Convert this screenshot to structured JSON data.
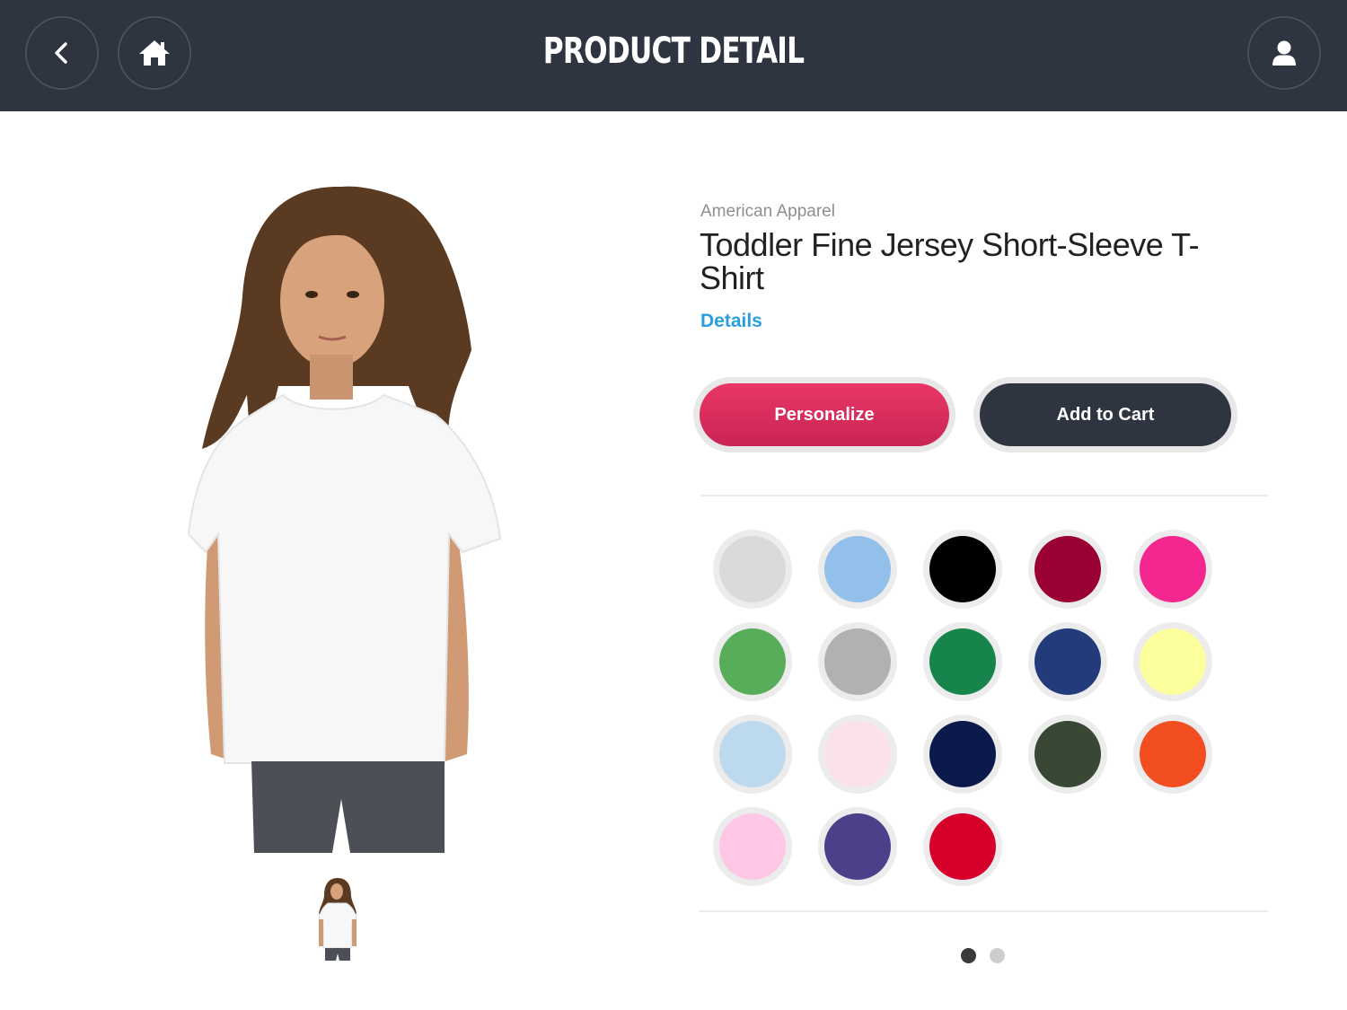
{
  "header": {
    "title": "PRODUCT DETAIL",
    "back_icon": "chevron-left-icon",
    "home_icon": "home-icon",
    "user_icon": "user-icon"
  },
  "product": {
    "brand": "American Apparel",
    "title": "Toddler Fine Jersey Short-Sleeve T-Shirt",
    "details_link": "Details",
    "personalize_label": "Personalize",
    "add_to_cart_label": "Add to Cart",
    "accent_color": "#d92d5c",
    "link_color": "#2a9fdf"
  },
  "swatches": [
    "#dadada",
    "#92c0ea",
    "#000000",
    "#9b0032",
    "#f42690",
    "#58ad5b",
    "#b1b1b1",
    "#17844c",
    "#233a7b",
    "#fdfe9c",
    "#bcd9ee",
    "#fbe1e8",
    "#0b1a4b",
    "#394735",
    "#f24e22",
    "#fec7e6",
    "#4b418b",
    "#d6002a"
  ],
  "pagination": {
    "pages": 2,
    "current": 1
  }
}
